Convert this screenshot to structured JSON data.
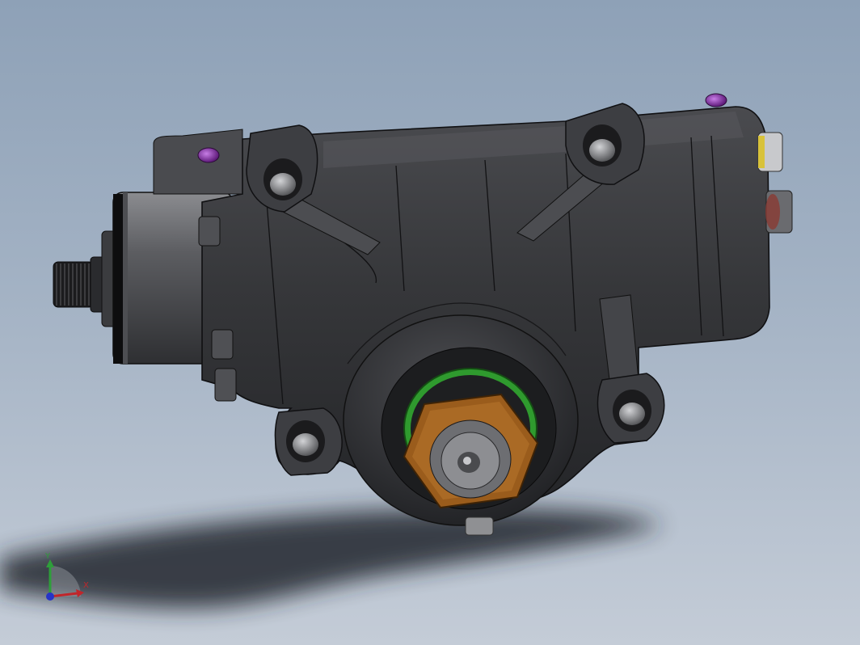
{
  "scene": {
    "model": "steering-gear-box",
    "colors": {
      "background_top": "#8ea1b7",
      "background_bottom": "#c4ccd7",
      "housing": "#3a3b3e",
      "edge": "#151517",
      "bolt": "#8f9093",
      "purple_plug": "#8a2fb0",
      "green_seal": "#2f9a2e",
      "bronze_nut": "#9a5c1c",
      "yellow_washer": "#d8c23a",
      "shadow": "#2a2d33"
    }
  },
  "triad": {
    "x_label": "X",
    "y_label": "Y",
    "z_label": "Z",
    "x_color": "#c0262b",
    "y_color": "#2e9e3a",
    "z_color": "#2634c8"
  }
}
